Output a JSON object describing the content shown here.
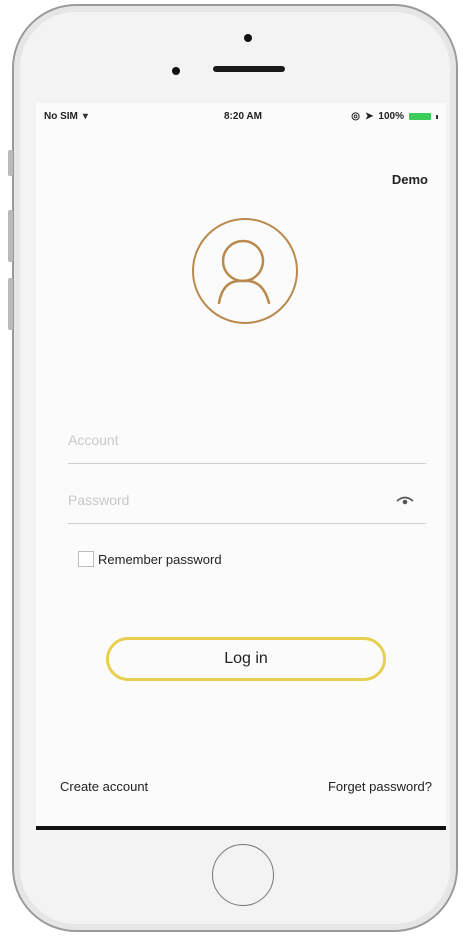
{
  "status_bar": {
    "carrier": "No SIM",
    "time": "8:20 AM",
    "battery": "100%"
  },
  "header": {
    "demo_label": "Demo"
  },
  "form": {
    "account_placeholder": "Account",
    "password_placeholder": "Password",
    "remember_label": "Remember password",
    "login_label": "Log in"
  },
  "footer": {
    "create_account": "Create account",
    "forget_password": "Forget password?"
  },
  "colors": {
    "accent_avatar": "#b98a4e",
    "login_border": "#e7cf4f",
    "battery": "#3ccd5a"
  },
  "icons": [
    "wifi-icon",
    "avatar-icon",
    "eye-icon",
    "alarm-icon",
    "location-icon"
  ]
}
